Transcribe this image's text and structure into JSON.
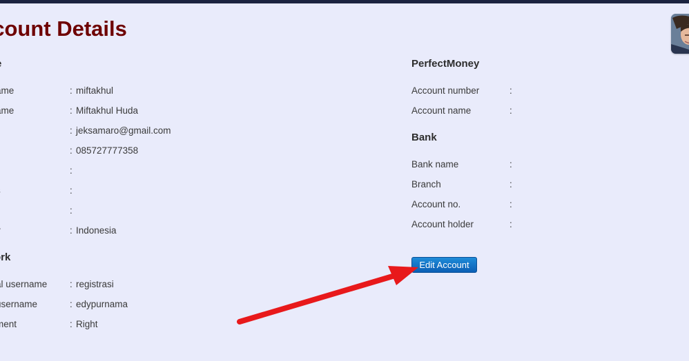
{
  "header": {
    "title": "ccount Details"
  },
  "profile": {
    "heading": "e",
    "rows": [
      {
        "label": "ame",
        "value": "miftakhul"
      },
      {
        "label": "ame",
        "value": "Miftakhul Huda"
      },
      {
        "label": "",
        "value": "jeksamaro@gmail.com"
      },
      {
        "label": "",
        "value": "085727777358"
      },
      {
        "label": "",
        "value": ""
      },
      {
        "label": "s",
        "value": ""
      },
      {
        "label": "",
        "value": ""
      },
      {
        "label": "y",
        "value": "Indonesia"
      }
    ]
  },
  "network": {
    "heading": "ork",
    "rows": [
      {
        "label": "al username",
        "value": "registrasi"
      },
      {
        "label": "username",
        "value": "edypurnama"
      },
      {
        "label": "ment",
        "value": "Right"
      }
    ]
  },
  "perfectmoney": {
    "heading": "PerfectMoney",
    "rows": [
      {
        "label": "Account number",
        "value": ""
      },
      {
        "label": "Account name",
        "value": ""
      }
    ]
  },
  "bank": {
    "heading": "Bank",
    "rows": [
      {
        "label": "Bank name",
        "value": ""
      },
      {
        "label": "Branch",
        "value": ""
      },
      {
        "label": "Account no.",
        "value": ""
      },
      {
        "label": "Account holder",
        "value": ""
      }
    ]
  },
  "separator": ":",
  "actions": {
    "edit_label": "Edit Account"
  },
  "colors": {
    "title": "#6e0000",
    "background": "#e9ebfb",
    "button": "#1574c8",
    "arrow": "#e8191b"
  }
}
